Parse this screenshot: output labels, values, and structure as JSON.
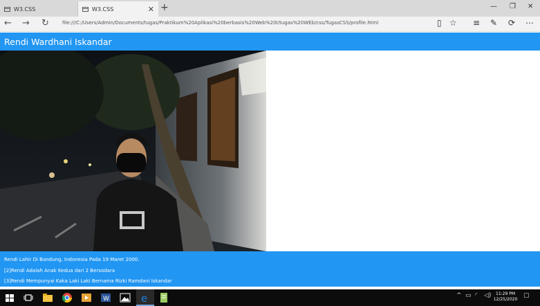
{
  "browser": {
    "tabs": [
      {
        "label": "W3.CSS"
      },
      {
        "label": "W3.CSS"
      }
    ],
    "new_tab": "+",
    "url": "file:///C:/Users/Admin/Documents/tugas/Praktikum%20Aplikasi%20berbasis%20Web%20I/tugas%20WEb/css/TugasCSS/profile.html",
    "colors": {
      "tabstrip": "#d9d9d9",
      "toolbar": "#f2f2f2"
    }
  },
  "page": {
    "header_title": "Rendi Wardhani Iskandar",
    "accent_color": "#2196f3",
    "footer_lines": [
      "Rendi Lahir Di Bandung, Indonesia Pada 19 Maret 2000.",
      "[2]Rendi Adalah Anak Kedua dari 2 Bersodara",
      "[3]Rendi Mempunyai Kaka Laki Laki Bernama Rizki Ramdani Iskandar"
    ]
  },
  "taskbar": {
    "time": "11:29 PM",
    "date": "12/25/2020"
  }
}
